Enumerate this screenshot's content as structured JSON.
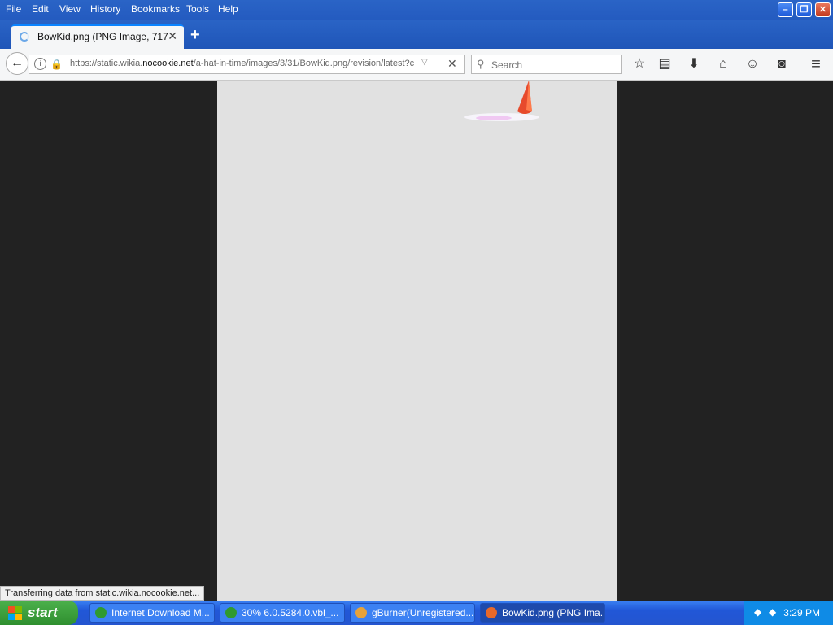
{
  "menu": {
    "items": [
      "File",
      "Edit",
      "View",
      "History",
      "Bookmarks",
      "Tools",
      "Help"
    ]
  },
  "window_controls": {
    "minimize": "–",
    "restore": "❐",
    "close": "✕"
  },
  "tab": {
    "title": "BowKid.png (PNG Image, 717 ...",
    "close": "✕"
  },
  "new_tab": "+",
  "navbar": {
    "back": "←",
    "url_prefix": "https://static.wikia.",
    "url_host": "nocookie.net",
    "url_path": "/a-hat-in-time/images/3/31/BowKid.png/revision/latest?c",
    "dropdown": "▽",
    "stop": "✕",
    "search_placeholder": "Search",
    "search_icon": "⚲",
    "toolbar_icons": [
      "star-icon",
      "reading-list-icon",
      "download-icon",
      "home-icon",
      "smiley-icon",
      "pocket-icon",
      "menu-icon"
    ],
    "toolbar_glyphs": [
      "☆",
      "▤",
      "⬇",
      "⌂",
      "☺",
      "◙",
      "≡"
    ]
  },
  "status_text": "Transferring data from static.wikia.nocookie.net...",
  "taskbar": {
    "start_label": "start",
    "tasks": [
      {
        "label": "Internet Download M...",
        "icon_color": "#2f9a2f"
      },
      {
        "label": "30% 6.0.5284.0.vbl_...",
        "icon_color": "#2f9a2f"
      },
      {
        "label": "gBurner(Unregistered...",
        "icon_color": "#e7a23a"
      },
      {
        "label": "BowKid.png (PNG Ima...",
        "icon_color": "#e8692a"
      }
    ],
    "clock": "3:29 PM"
  },
  "colors": {
    "titlebar": "#245bc0",
    "page_bg": "#222222",
    "image_bg": "#e1e1e1",
    "accent": "#0a84ff"
  }
}
